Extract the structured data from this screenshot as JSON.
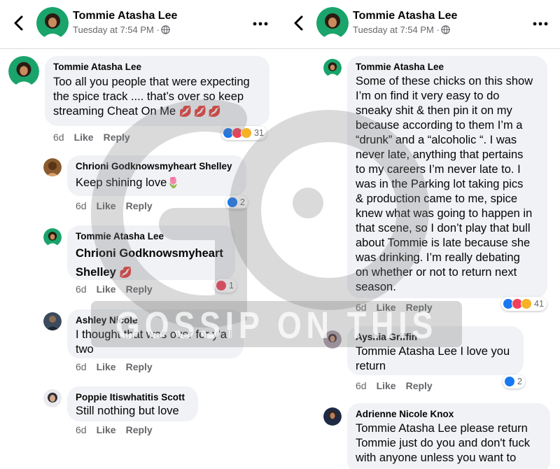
{
  "header": {
    "name": "Tommie Atasha Lee",
    "time": "Tuesday at 7:54 PM ·"
  },
  "left_comments": [
    {
      "name": "Tommie Atasha Lee",
      "lines": [
        "Too all you people that were expecting",
        "the spice track .... that’s over so keep",
        "streaming Cheat On Me"
      ],
      "emoji": "💋💋💋",
      "age": "6d",
      "like": "Like",
      "reply": "Reply",
      "reactions": "31"
    },
    {
      "name": "Chrioni Godknowsmyheart Shelley",
      "lines": [
        "Keep shining love"
      ],
      "emoji": "🌷",
      "age": "6d",
      "like": "Like",
      "reply": "Reply",
      "reactions": "2"
    },
    {
      "name": "Tommie Atasha Lee",
      "lines": [
        "Chrioni Godknowsmyheart",
        "Shelley"
      ],
      "emoji": "💋",
      "age": "6d",
      "like": "Like",
      "reply": "Reply",
      "reactions": "1"
    },
    {
      "name": "Ashley Nicole",
      "lines": [
        "I thought that was over for y'all",
        "two"
      ],
      "age": "6d",
      "like": "Like",
      "reply": "Reply"
    },
    {
      "name": "Poppie Itiswhatitis Scott",
      "lines": [
        "Still nothing but love"
      ],
      "age": "6d",
      "like": "Like",
      "reply": "Reply"
    }
  ],
  "right_comments": [
    {
      "name": "Tommie Atasha Lee",
      "lines": [
        "Some of these chicks on this show",
        "I’m on find it very easy to do",
        "sneaky shit & then pin it on my",
        "because according to them I’m a",
        "“drunk”  and a “alcoholic “. I was",
        "never late, anything that pertains",
        "to my careers I’m never late to. I",
        "was in the Parking lot taking pics",
        "& production came to me, spice",
        "knew what was going to happen in",
        "that scene, so I don’t play that bull",
        "about Tommie is late because she",
        "was drinking. I’m really debating",
        "on whether or not to return next",
        "season."
      ],
      "age": "6d",
      "like": "Like",
      "reply": "Reply",
      "reactions": "41"
    },
    {
      "name": "Ayshia Griffin",
      "lines": [
        "Tommie Atasha Lee I love you",
        "return"
      ],
      "age": "6d",
      "like": "Like",
      "reply": "Reply",
      "reactions": "2"
    },
    {
      "name": "Adrienne Nicole Knox",
      "lines": [
        "Tommie Atasha Lee please return",
        "Tommie just do you and don't fuck",
        "with anyone unless you want to"
      ]
    }
  ],
  "watermark": "GOSSIP ON THIS",
  "colors": {
    "like_blue": "#1877f2",
    "love_red": "#f33e58",
    "meta_gray": "#65676b",
    "bubble": "#f0f2f5"
  }
}
